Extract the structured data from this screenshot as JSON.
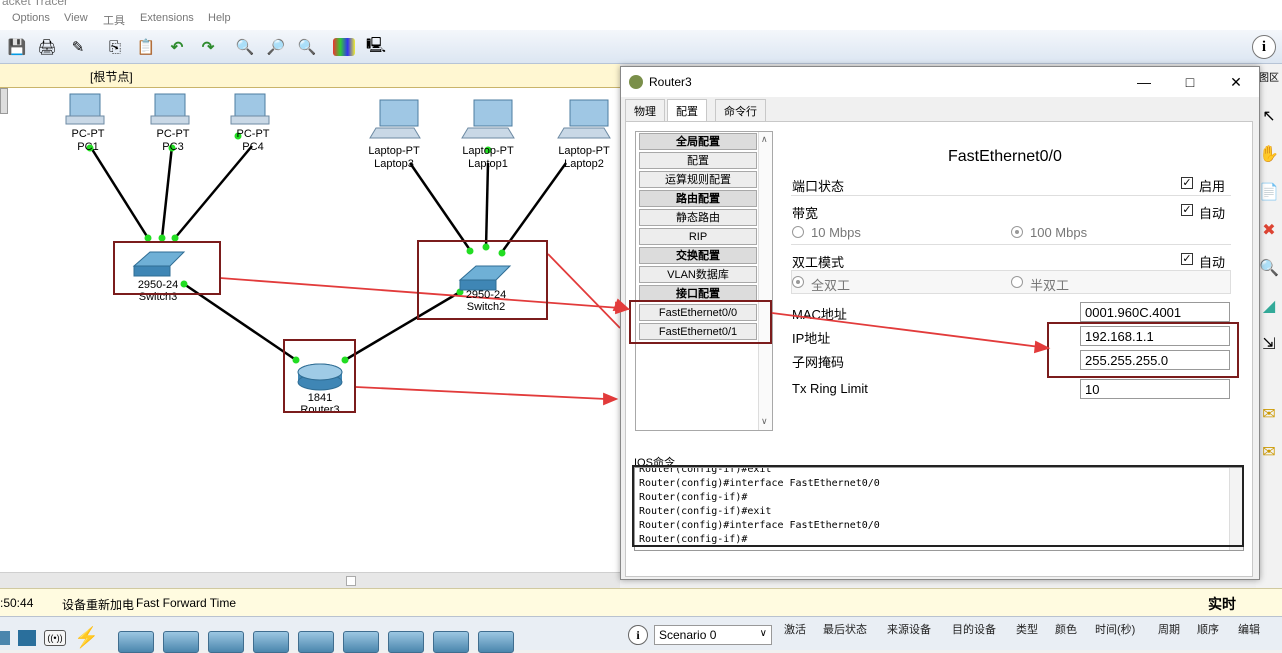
{
  "app": {
    "title_partial": "acket Tracer",
    "menu": [
      "Options",
      "View",
      "工具",
      "Extensions",
      "Help"
    ],
    "breadcrumb": "[根节点]"
  },
  "toolbar_icons": [
    "save-icon",
    "print-icon",
    "activity-wizard-icon",
    "copy-icon",
    "paste-icon",
    "undo-icon",
    "redo-icon",
    "zoom-in-icon",
    "zoom-reset-icon",
    "zoom-out-icon",
    "palette-icon",
    "custom-device-icon",
    "info-icon"
  ],
  "topology": {
    "pcs": [
      {
        "type": "PC-PT",
        "name": "PC1"
      },
      {
        "type": "PC-PT",
        "name": "PC3"
      },
      {
        "type": "PC-PT",
        "name": "PC4"
      }
    ],
    "laptops": [
      {
        "type": "Laptop-PT",
        "name": "Laptop3"
      },
      {
        "type": "Laptop-PT",
        "name": "Laptop1"
      },
      {
        "type": "Laptop-PT",
        "name": "Laptop2"
      }
    ],
    "switches": [
      {
        "model": "2950-24",
        "name": "Switch3"
      },
      {
        "model": "2950-24",
        "name": "Switch2"
      }
    ],
    "router": {
      "model": "1841",
      "name": "Router3"
    },
    "link_color": "#000000",
    "port_color": "#22dd22",
    "annotation_color": "#e23b3b"
  },
  "dialog": {
    "title": "Router3",
    "tabs": [
      "物理",
      "配置",
      "命令行"
    ],
    "active_tab": "配置",
    "nav": {
      "global_header": "全局配置",
      "items_global": [
        "配置",
        "运算规则配置"
      ],
      "routing_header": "路由配置",
      "items_routing": [
        "静态路由",
        "RIP"
      ],
      "switching_header": "交换配置",
      "items_switching": [
        "VLAN数据库"
      ],
      "interface_header": "接口配置",
      "interfaces": [
        "FastEthernet0/0",
        "FastEthernet0/1"
      ]
    },
    "config": {
      "interface_title": "FastEthernet0/0",
      "port_status_label": "端口状态",
      "port_status_value": "启用",
      "port_status_checked": true,
      "bandwidth_label": "带宽",
      "bandwidth_auto": "自动",
      "bandwidth_options": [
        "10 Mbps",
        "100 Mbps"
      ],
      "bandwidth_selected": "100 Mbps",
      "duplex_label": "双工模式",
      "duplex_auto": "自动",
      "duplex_options": [
        "全双工",
        "半双工"
      ],
      "duplex_selected": "全双工",
      "mac_label": "MAC地址",
      "mac_value": "0001.960C.4001",
      "ip_label": "IP地址",
      "ip_value": "192.168.1.1",
      "mask_label": "子网掩码",
      "mask_value": "255.255.255.0",
      "ring_label": "Tx Ring Limit",
      "ring_value": "10"
    },
    "ios": {
      "label": "IOS命令",
      "lines": [
        "Router(config-if)#exit",
        "Router(config)#interface FastEthernet0/0",
        "Router(config-if)#",
        "Router(config-if)#exit",
        "Router(config)#interface FastEthernet0/0",
        "Router(config-if)#"
      ]
    }
  },
  "status": {
    "time": ":50:44",
    "message": "设备重新加电",
    "mode": "Fast Forward Time",
    "realtime": "实时"
  },
  "bottom": {
    "scenario": "Scenario 0",
    "pdu_columns": [
      "激活",
      "最后状态",
      "来源设备",
      "目的设备",
      "类型",
      "颜色",
      "时间(秒)",
      "周期",
      "顺序",
      "编辑"
    ]
  }
}
